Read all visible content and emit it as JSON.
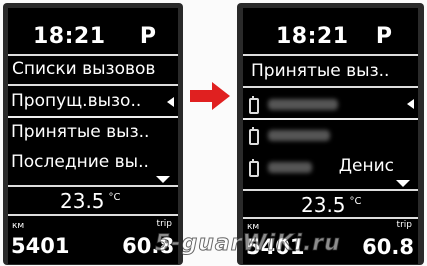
{
  "colors": {
    "arrow": "#e02020",
    "screen_bg": "#000000",
    "text": "#ffffff"
  },
  "left_screen": {
    "time": "18:21",
    "gear": "P",
    "title": "Списки вызовов",
    "items": [
      {
        "label": "Пропущ.вызо.."
      },
      {
        "label": "Принятые выз.."
      },
      {
        "label": "Последние вы.."
      }
    ],
    "temperature": "23.5",
    "temperature_unit": "°C",
    "odo_label": "км",
    "odo_value": "5401",
    "trip_label": "trip",
    "trip_value": "60.8"
  },
  "right_screen": {
    "time": "18:21",
    "gear": "P",
    "title": "Принятые выз..",
    "contacts": [
      {
        "name": "",
        "icon": "phone-icon"
      },
      {
        "name": "",
        "icon": "phone-icon"
      },
      {
        "name": "Денис",
        "icon": "phone-icon"
      }
    ],
    "temperature": "23.5",
    "temperature_unit": "°C",
    "odo_label": "км",
    "odo_value": "5401",
    "trip_label": "trip",
    "trip_value": "60.8"
  },
  "transition_arrow_icon": "arrow-right-icon",
  "watermark": "5-guarWiKi.ru"
}
